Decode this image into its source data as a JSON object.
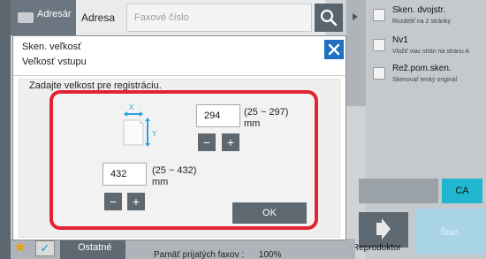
{
  "header": {
    "address_book_tab": "Adresár",
    "address_label": "Adresa",
    "fax_placeholder": "Faxové číslo"
  },
  "side_panel": {
    "items": [
      {
        "title": "Sken. dvojstr.",
        "subtitle": "Rozdeliť na 2 stránky"
      },
      {
        "title": "Nv1",
        "subtitle": "Vložiť viac strán na stranu A"
      },
      {
        "title": "Rež.pom.sken.",
        "subtitle": "Skenovať tenký originál"
      }
    ],
    "ca_label": "CA",
    "speaker_label": "Reproduktor",
    "start_label": "Štart"
  },
  "footer": {
    "other_label": "Ostatné",
    "memory_text": "Pamäť prijatých faxov :",
    "memory_value": "100%"
  },
  "dialog": {
    "title": "Sken. veľkosť",
    "subtitle": "Veľkosť vstupu",
    "instruction": "Zadajte velkost pre registráciu.",
    "x_axis": "X",
    "y_axis": "Y",
    "x_value": "294",
    "x_range": "(25 ~ 297)",
    "x_unit": "mm",
    "y_value": "432",
    "y_range": "(25 ~ 432)",
    "y_unit": "mm",
    "minus": "−",
    "plus": "+",
    "ok_label": "OK"
  },
  "colors": {
    "highlight_frame": "#e1242f",
    "close_button": "#1f71c0",
    "ca_button": "#20b6cf",
    "axis_icon": "#2aa1d8"
  },
  "icons": [
    "address-book-icon",
    "search-icon",
    "close-icon",
    "speaker-icon",
    "star-icon",
    "check-icon",
    "paper-size-icon"
  ]
}
